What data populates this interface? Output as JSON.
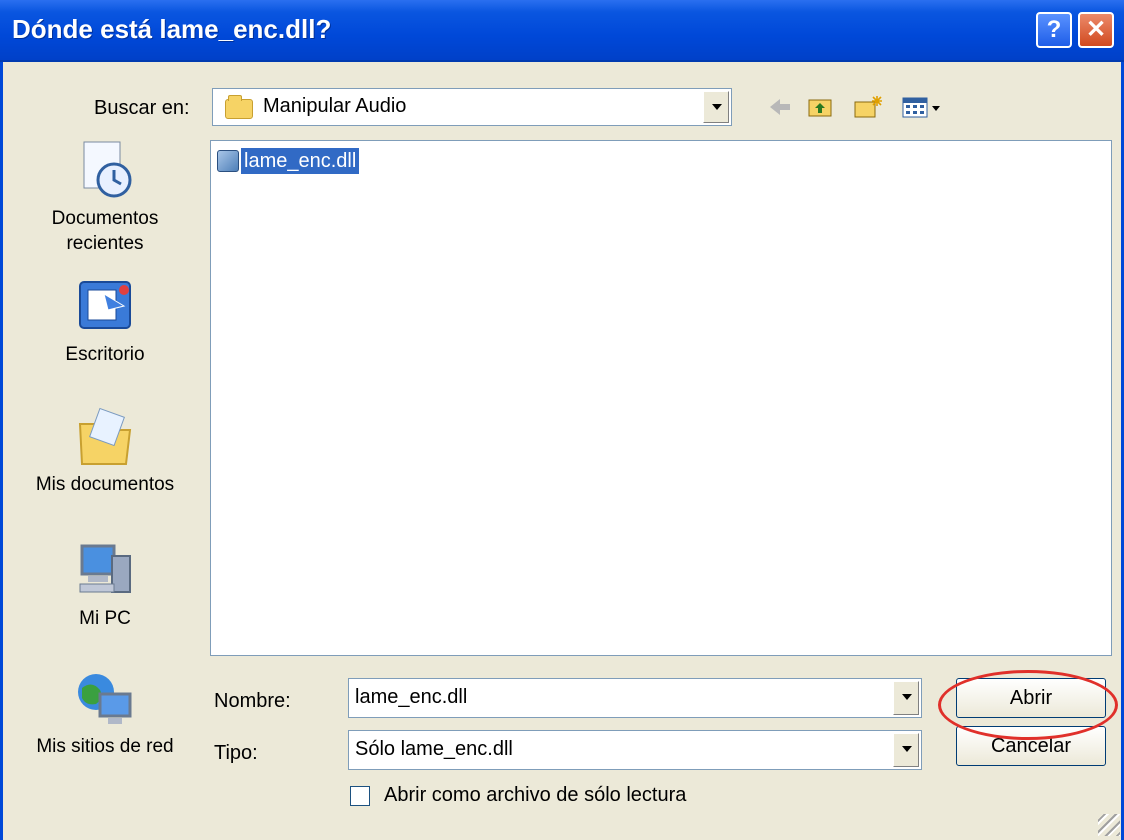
{
  "window": {
    "title": "Dónde está lame_enc.dll?",
    "help_glyph": "?",
    "close_glyph": "✕"
  },
  "look_in": {
    "label": "Buscar en:",
    "value": "Manipular Audio"
  },
  "toolbar": {
    "icons": [
      "back-arrow-icon",
      "up-folder-icon",
      "new-folder-icon",
      "view-menu-icon"
    ]
  },
  "places": [
    {
      "label": "Documentos\nrecientes",
      "icon": "recent-documents-icon"
    },
    {
      "label": "Escritorio",
      "icon": "desktop-icon"
    },
    {
      "label": "Mis documentos",
      "icon": "my-documents-icon"
    },
    {
      "label": "Mi PC",
      "icon": "my-computer-icon"
    },
    {
      "label": "Mis sitios de red",
      "icon": "network-places-icon"
    }
  ],
  "files": [
    {
      "name": "lame_enc.dll",
      "selected": true
    }
  ],
  "filename": {
    "label": "Nombre:",
    "value": "lame_enc.dll"
  },
  "filetype": {
    "label": "Tipo:",
    "value": "Sólo lame_enc.dll"
  },
  "readonly": {
    "label": "Abrir como archivo de sólo lectura",
    "checked": false
  },
  "buttons": {
    "open": "Abrir",
    "cancel": "Cancelar"
  },
  "colors": {
    "titlebar": "#0048d8",
    "selection": "#316ac5",
    "annotation": "#e0302a"
  }
}
